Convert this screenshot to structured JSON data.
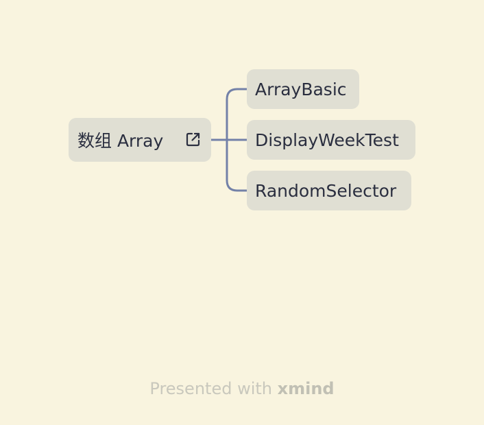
{
  "mindmap": {
    "root": {
      "label": "数组 Array",
      "icon": "external-link-icon"
    },
    "children": [
      {
        "label": "ArrayBasic"
      },
      {
        "label": "DisplayWeekTest"
      },
      {
        "label": "RandomSelector"
      }
    ],
    "colors": {
      "background": "#f9f4df",
      "node_fill": "#e0dfd3",
      "connector": "#7381a8",
      "text": "#2a2e3f"
    }
  },
  "footer": {
    "prefix": "Presented with",
    "brand": "xmind"
  }
}
